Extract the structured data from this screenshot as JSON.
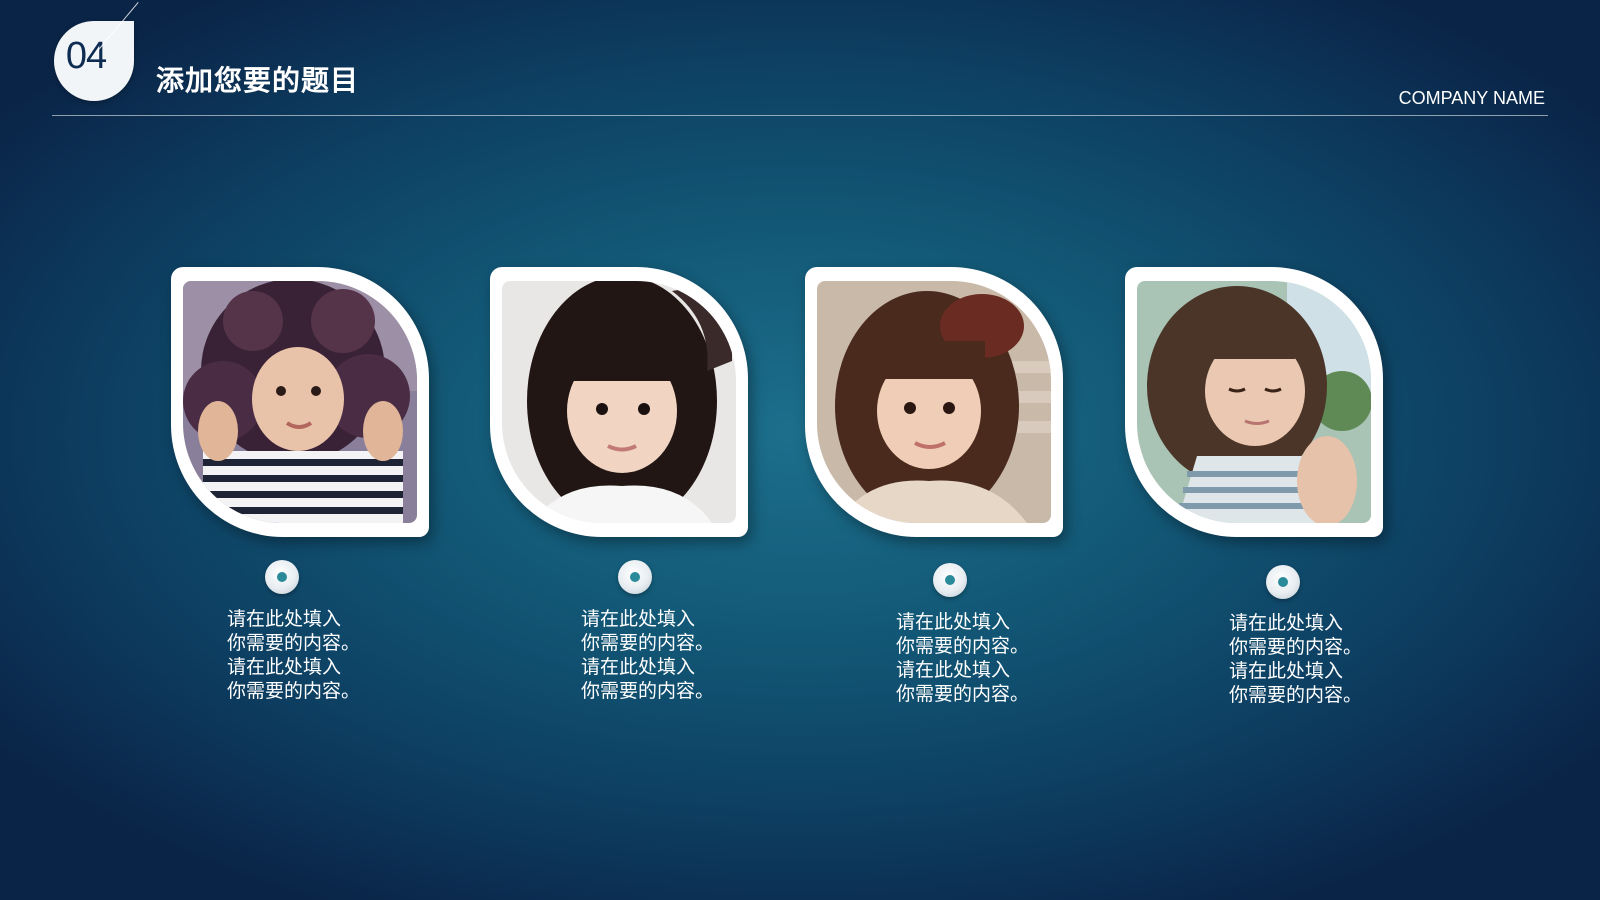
{
  "header": {
    "section_number": "04",
    "title": "添加您要的题目",
    "company": "COMPANY NAME"
  },
  "cards": [
    {
      "photo": "girl-curly-hair-photo",
      "lines": [
        "请在此处填入",
        "你需要的内容。",
        "请在此处填入",
        "你需要的内容。"
      ]
    },
    {
      "photo": "girl-long-dark-hair-photo",
      "lines": [
        "请在此处填入",
        "你需要的内容。",
        "请在此处填入",
        "你需要的内容。"
      ]
    },
    {
      "photo": "girl-bow-headband-photo",
      "lines": [
        "请在此处填入",
        "你需要的内容。",
        "请在此处填入",
        "你需要的内容。"
      ]
    },
    {
      "photo": "girl-looking-down-photo",
      "lines": [
        "请在此处填入",
        "你需要的内容。",
        "请在此处填入",
        "你需要的内容。"
      ]
    }
  ],
  "colors": {
    "background_center": "#1c6f8c",
    "background_edge": "#0a2447",
    "badge": "#f2f5f8",
    "badge_text": "#0e2c52",
    "text": "#ffffff"
  }
}
